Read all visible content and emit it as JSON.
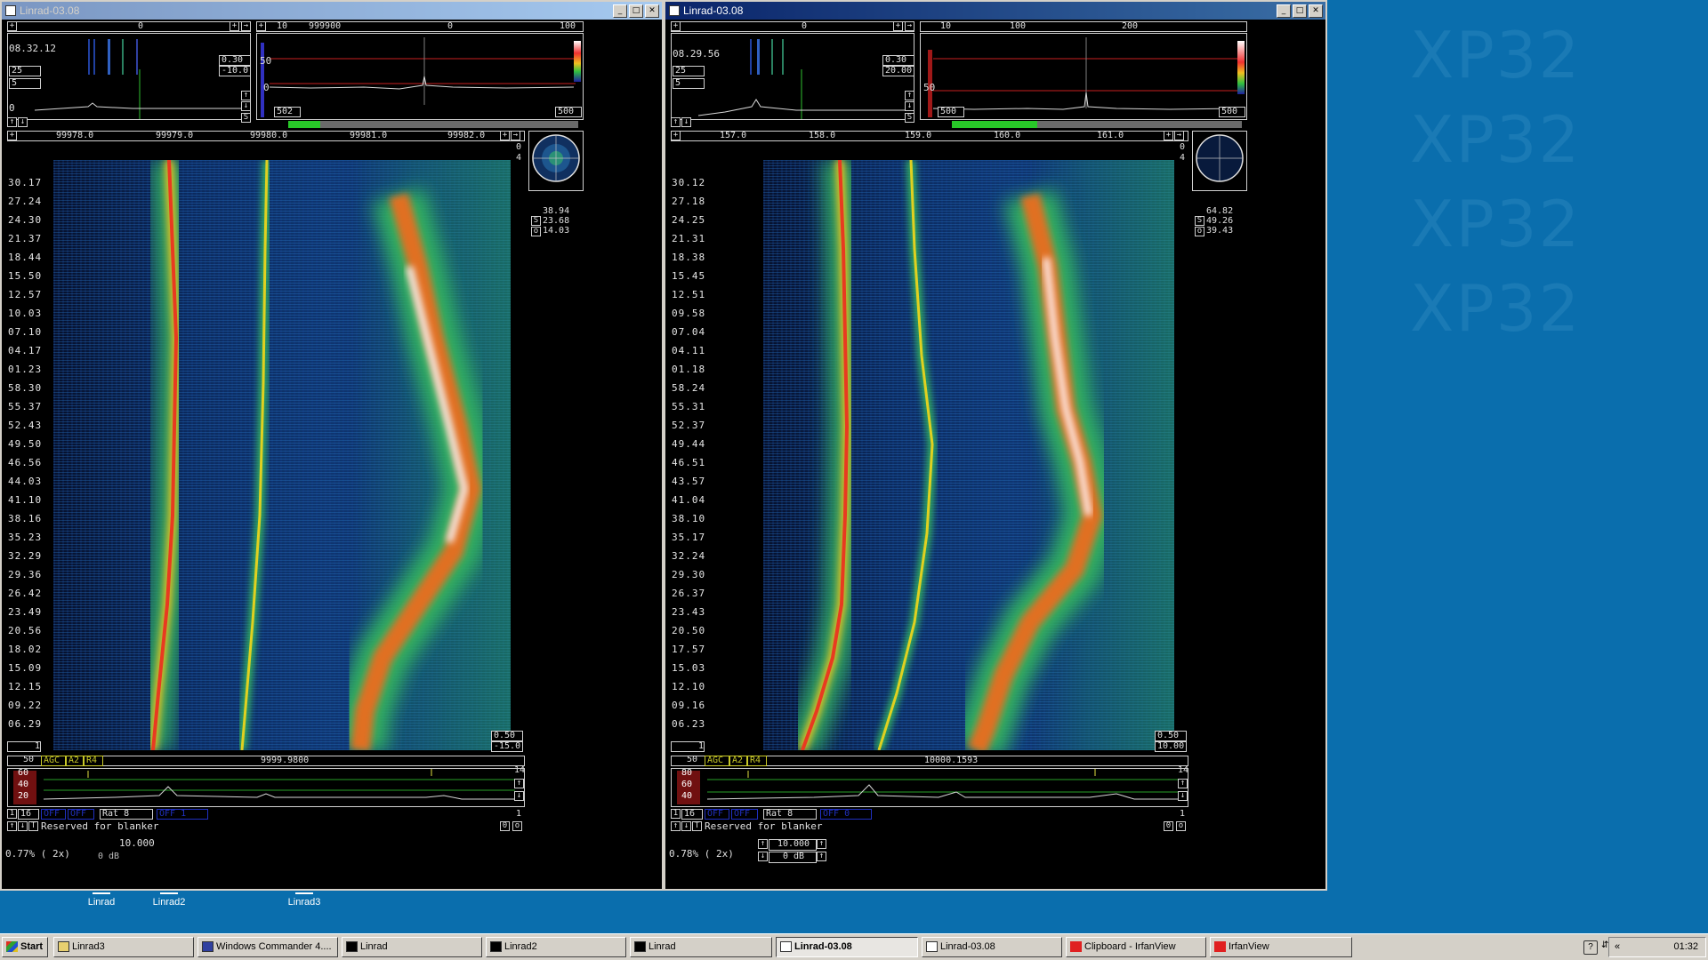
{
  "watermark": [
    "XP32",
    "XP32",
    "XP32",
    "XP32"
  ],
  "colors": {
    "desktop": "#0a6ead",
    "accent_green": "#28c828",
    "accent_red": "#c82828",
    "title_active": "#0a246a"
  },
  "win1": {
    "title": "Linrad-03.08",
    "time": "08.32.12",
    "vals": {
      "v025": "25",
      "v5": "5",
      "v0": "0",
      "small1": "0.30",
      "small2": "-10.0",
      "hires_l": "502",
      "hires_r": "500",
      "hires_0": "0",
      "hires_50": "50"
    },
    "hires_scale": [
      "10",
      "999900",
      "0",
      "100"
    ],
    "top_scale_mark": "0",
    "wf_scale": [
      "99978.0",
      "99979.0",
      "99980.0",
      "99981.0",
      "99982.0"
    ],
    "wf_side": [
      "0",
      "4"
    ],
    "polar_vals": [
      "38.94",
      "23.68",
      "14.03"
    ],
    "time_labels": [
      "30.17",
      "27.24",
      "24.30",
      "21.37",
      "18.44",
      "15.50",
      "12.57",
      "10.03",
      "07.10",
      "04.17",
      "01.23",
      "58.30",
      "55.37",
      "52.43",
      "49.50",
      "46.56",
      "44.03",
      "41.10",
      "38.16",
      "35.23",
      "32.29",
      "29.36",
      "26.42",
      "23.49",
      "20.56",
      "18.02",
      "15.09",
      "12.15",
      "09.22",
      "06.29"
    ],
    "wf_bottom_r1": "0.50",
    "wf_bottom_r2": "-15.0",
    "wf_bottom_l": "1",
    "bg_freq": "9999.9800",
    "bg_50": "50",
    "agc": "AGC",
    "a2": "A2",
    "r4": "R4",
    "bg_14": "14",
    "bg_db": [
      "60",
      "40",
      "20"
    ],
    "ctrl": {
      "n1": "1",
      "n16": "16",
      "offa": "OFF",
      "offb": "OFF",
      "rat": "Rat  8",
      "offc": "OFF  1",
      "one": "1",
      "blanker": "Reserved for blanker",
      "zero": "0"
    },
    "status": "0.77%  ( 2x)",
    "freq_box": "10.000",
    "db_box": "0 dB"
  },
  "win2": {
    "title": "Linrad-03.08",
    "time": "08.29.56",
    "vals": {
      "v025": "25",
      "v5": "5",
      "small1": "0.30",
      "small2": "20.00",
      "hires_l": "500",
      "hires_r": "500",
      "hires_50": "50"
    },
    "hires_scale": [
      "10",
      "100",
      "200"
    ],
    "top_scale_mark": "0",
    "wf_scale": [
      "157.0",
      "158.0",
      "159.0",
      "160.0",
      "161.0"
    ],
    "wf_side": [
      "0",
      "4"
    ],
    "polar_vals": [
      "64.82",
      "49.26",
      "39.43"
    ],
    "time_labels": [
      "30.12",
      "27.18",
      "24.25",
      "21.31",
      "18.38",
      "15.45",
      "12.51",
      "09.58",
      "07.04",
      "04.11",
      "01.18",
      "58.24",
      "55.31",
      "52.37",
      "49.44",
      "46.51",
      "43.57",
      "41.04",
      "38.10",
      "35.17",
      "32.24",
      "29.30",
      "26.37",
      "23.43",
      "20.50",
      "17.57",
      "15.03",
      "12.10",
      "09.16",
      "06.23"
    ],
    "wf_bottom_r1": "0.50",
    "wf_bottom_r2": "10.00",
    "wf_bottom_l": "1",
    "bg_freq": "10000.1593",
    "bg_50": "50",
    "agc": "AGC",
    "a2": "A2",
    "r4": "R4",
    "bg_14": "14",
    "bg_db": [
      "80",
      "60",
      "40"
    ],
    "ctrl": {
      "n1": "1",
      "n16": "16",
      "offa": "OFF",
      "offb": "OFF",
      "rat": "Rat  8",
      "offc": "OFF  0",
      "one": "1",
      "blanker": "Reserved for blanker",
      "zero": "0"
    },
    "status": "0.78%  ( 2x)",
    "freq_box": "10.000",
    "db_box": "0 dB"
  },
  "desktop_icons": [
    "Linrad",
    "Linrad2",
    "Linrad3"
  ],
  "taskbar": {
    "start": "Start",
    "items": [
      "Linrad3",
      "Windows Commander 4....",
      "Linrad",
      "Linrad2",
      "Linrad",
      "Linrad-03.08",
      "Linrad-03.08",
      "Clipboard - IrfanView",
      "IrfanView"
    ],
    "clock": "01:32",
    "tray_arrow": "«"
  }
}
